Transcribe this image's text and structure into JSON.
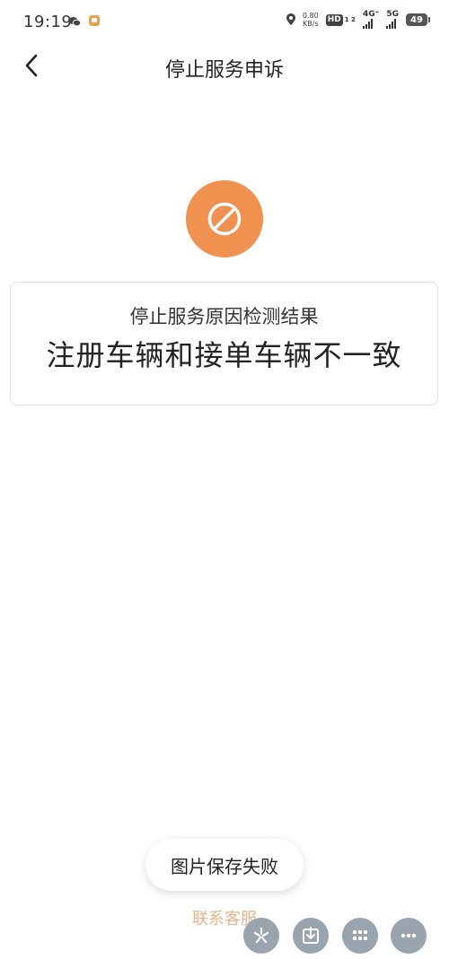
{
  "status_bar": {
    "time": "19:19",
    "net_speed_value": "0.80",
    "net_speed_unit": "KB/s",
    "hd_label": "HD",
    "hd_sub": "1 2",
    "signal_1": "4G⁺",
    "signal_2": "5G",
    "battery": "49"
  },
  "header": {
    "title": "停止服务申诉"
  },
  "status_icon": "stop-icon",
  "result": {
    "caption": "停止服务原因检测结果",
    "reason": "注册车辆和接单车辆不一致"
  },
  "toast": {
    "message": "图片保存失败"
  },
  "footer": {
    "contact_label": "联系客服"
  },
  "toolbar": {
    "icons": [
      "sparkle-icon",
      "download-icon",
      "grid-icon",
      "more-icon"
    ]
  },
  "colors": {
    "accent": "#f0914f",
    "contact_link": "#e8b48b",
    "floating_button": "#9aa4ae"
  }
}
